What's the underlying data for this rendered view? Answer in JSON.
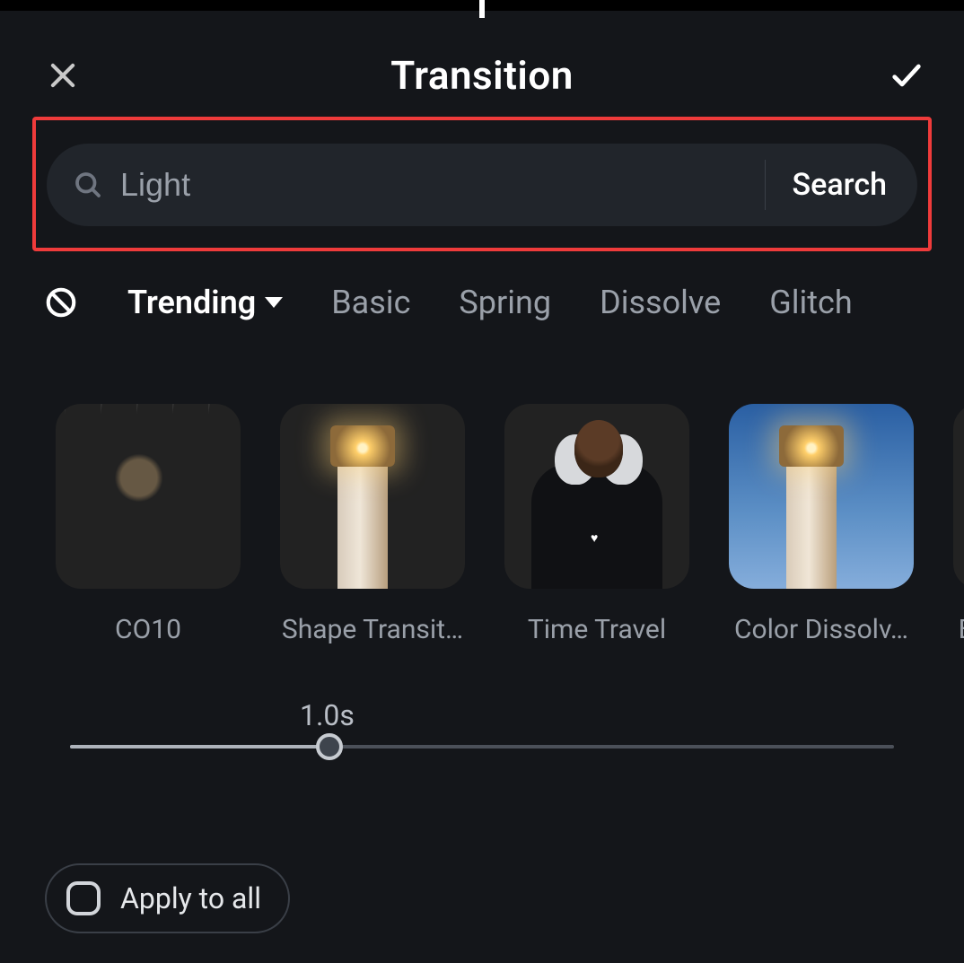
{
  "header": {
    "title": "Transition"
  },
  "search": {
    "value": "Light",
    "button_label": "Search"
  },
  "categories": {
    "active": "Trending",
    "items": [
      "Trending",
      "Basic",
      "Spring",
      "Dissolve",
      "Glitch"
    ]
  },
  "transitions": [
    {
      "label": "CO10"
    },
    {
      "label": "Shape Transit…"
    },
    {
      "label": "Time Travel"
    },
    {
      "label": "Color Dissolv…"
    },
    {
      "label": "B"
    }
  ],
  "duration": {
    "display": "1.0s"
  },
  "apply_all": {
    "label": "Apply to all"
  }
}
